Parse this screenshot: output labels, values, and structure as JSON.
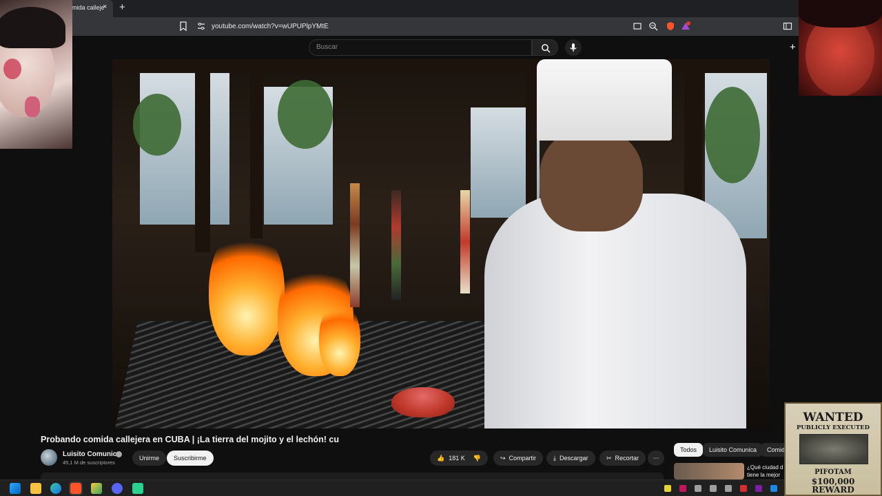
{
  "browser": {
    "tab_title": "mida calleje",
    "tab_close": "×",
    "new_tab": "+",
    "url": "youtube.com/watch?v=wUPUPlpYMtE",
    "brave_badge": "1"
  },
  "header": {
    "search_placeholder": "Buscar",
    "create_glyph": "+"
  },
  "video": {
    "title": "Probando comida callejera en CUBA | ¡La tierra del mojito y el lechón! cu"
  },
  "channel": {
    "name": "Luisito Comunica",
    "subscribers": "45,1 M de suscriptores",
    "join_label": "Unirme",
    "subscribe_label": "Suscribirme"
  },
  "actions": {
    "likes": "181 K",
    "share": "Compartir",
    "download": "Descargar",
    "clip": "Recortar",
    "more": "⋯"
  },
  "chips": [
    "Todos",
    "Luisito Comunica",
    "Comid"
  ],
  "recommendation": {
    "line1": "¿Qué ciudad d",
    "line2": "tiene la mejor"
  },
  "wanted_poster": {
    "title": "WANTED",
    "subtitle": "PUBLICLY EXECUTED",
    "name": "PIFOTAM",
    "amount": "$100,000",
    "reward": "REWARD"
  },
  "colors": {
    "yt_bg": "#0f0f0f",
    "accent_red": "#ff0000",
    "chip_active": "#f1f1f1"
  }
}
